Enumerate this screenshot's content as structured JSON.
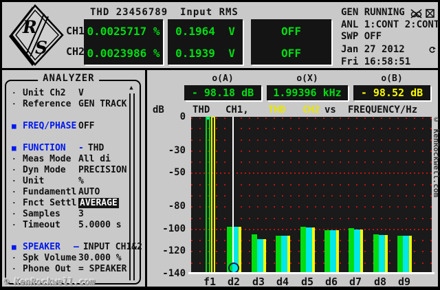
{
  "header": {
    "thd": {
      "title": "THD 23456789",
      "ch1_label": "CH1",
      "ch2_label": "CH2",
      "ch1_value": "0.0025717 %",
      "ch2_value": "0.0023986 %"
    },
    "input_rms": {
      "title": "Input RMS",
      "ch1_value": "0.1964  V",
      "ch2_value": "0.1939  V"
    },
    "aux": {
      "ch1_value": "OFF",
      "ch2_value": "OFF"
    },
    "status": {
      "line1": "GEN RUNNING",
      "line2": "ANL 1:CONT 2:CONT",
      "line3": "SWP OFF",
      "date": "Jan 27 2012",
      "time": "Fri 16:58:51"
    }
  },
  "menu": {
    "title": "ANALYZER",
    "items": [
      {
        "marker": "·",
        "label": "Unit Ch2",
        "value": "V"
      },
      {
        "marker": "·",
        "label": "Reference",
        "value": "GEN TRACK"
      },
      {
        "gap": true
      },
      {
        "marker": "■",
        "label": "FREQ/PHASE",
        "value": "OFF",
        "blue": true
      },
      {
        "gap": true
      },
      {
        "marker": "■",
        "label": "FUNCTION",
        "sep": "-",
        "value": "THD",
        "blue": true
      },
      {
        "marker": "·",
        "label": "Meas Mode",
        "value": "All di"
      },
      {
        "marker": "·",
        "label": "Dyn Mode",
        "value": "PRECISION"
      },
      {
        "marker": "·",
        "label": "Unit",
        "value": "%"
      },
      {
        "marker": "·",
        "label": "Fundamentl",
        "value": "AUTO"
      },
      {
        "marker": "·",
        "label": "Fnct Settl",
        "value": "AVERAGE",
        "inverted": true
      },
      {
        "marker": "·",
        "label": "Samples",
        "value": "3"
      },
      {
        "marker": "·",
        "label": "Timeout",
        "value": "5.0000 s"
      },
      {
        "gap": true
      },
      {
        "marker": "■",
        "label": "SPEAKER",
        "sep": "—",
        "value": "INPUT CH1&2",
        "blue": true
      },
      {
        "marker": "·",
        "label": "Spk Volume",
        "value": "30.000 %"
      },
      {
        "marker": "·",
        "label": "Phone Out",
        "value": "= SPEAKER"
      }
    ]
  },
  "chart_data": {
    "type": "bar",
    "ylabel": "dB",
    "title_parts": {
      "thd1": "THD",
      "ch1": "CH1,",
      "thd2": "THD",
      "ch2": "CH2",
      "vs": "vs",
      "xlabel": "FREQUENCY/Hz"
    },
    "ylim": [
      -140,
      0
    ],
    "yticks": [
      0,
      -30,
      -50,
      -80,
      -100,
      -120,
      -140
    ],
    "grid": {
      "step": 10,
      "color": "#c21212",
      "emphasis": [
        -50,
        -100
      ]
    },
    "categories": [
      "f1",
      "d2",
      "d3",
      "d4",
      "d5",
      "d6",
      "d7",
      "d8",
      "d9"
    ],
    "series": [
      {
        "name": "THD CH1",
        "color": "#00dd11",
        "values": [
          0,
          -98.2,
          -105,
          -106,
          -98.3,
          -101.5,
          -99.5,
          -105,
          -106.5
        ]
      },
      {
        "name": "THD CH2",
        "color": "#00e8e8",
        "edge_color": "#f8f800",
        "values": [
          0,
          -98.5,
          -109.5,
          -106,
          -99,
          -101.5,
          -101,
          -105.5,
          -106.5
        ]
      }
    ],
    "cursor": {
      "category": "d2",
      "readouts": {
        "a_label": "o(A)",
        "a_value": "- 98.18 dB",
        "x_label": "o(X)",
        "x_value": "1.99396 kHz",
        "b_label": "o(B)",
        "b_value": "- 98.52 dB"
      }
    }
  },
  "watermark": {
    "bottom_left": "© KenRockwell.com",
    "right": "© KenRockwell.com"
  },
  "colors": {
    "bg": "#c9c9c9",
    "display_bg": "#141414",
    "green": "#00dd11",
    "yellow": "#f8f800",
    "cyan": "#00e8e8",
    "blue": "#0018ee",
    "grid_red": "#c21212"
  }
}
